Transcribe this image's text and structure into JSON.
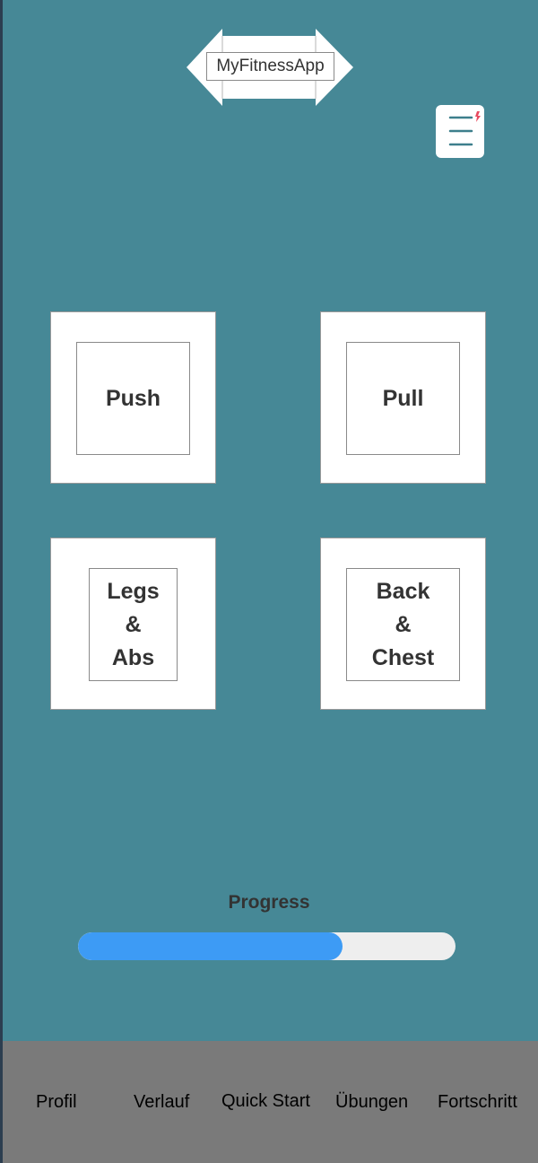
{
  "header": {
    "logo_text": "MyFitnessApp",
    "menu_icon": "hamburger-menu-icon"
  },
  "workouts": [
    {
      "label": "Push"
    },
    {
      "label": "Pull"
    },
    {
      "label": "Legs\n&\nAbs"
    },
    {
      "label": "Back\n&\nChest"
    }
  ],
  "progress": {
    "label": "Progress",
    "value_fraction": 0.7
  },
  "bottom_nav": {
    "items": [
      {
        "label": "Profil"
      },
      {
        "label": "Verlauf"
      },
      {
        "label": "Quick Start"
      },
      {
        "label": "Übungen"
      },
      {
        "label": "Fortschritt"
      }
    ]
  },
  "colors": {
    "background": "#468896",
    "tile": "#ffffff",
    "progress_fill": "#3d9bf5",
    "progress_track": "#eeeeee",
    "nav_bar": "#7a7a7a",
    "notification_dot": "#e84a5f"
  }
}
